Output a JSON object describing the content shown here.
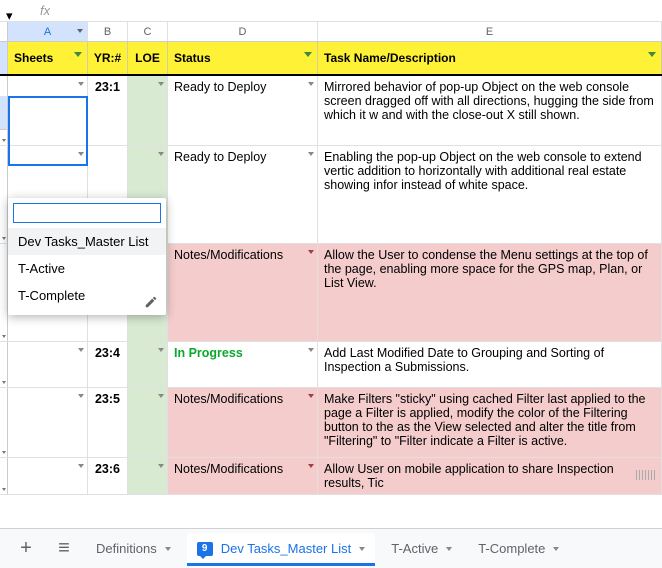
{
  "formula": {
    "fx": "fx",
    "value": ""
  },
  "col_letters": [
    "A",
    "B",
    "C",
    "D",
    "E"
  ],
  "headers": {
    "sheets": "Sheets",
    "yr": "YR:#",
    "loe": "LOE",
    "status": "Status",
    "task": "Task Name/Description"
  },
  "rows": [
    {
      "yr": "23:1",
      "status": "Ready to Deploy",
      "status_class": "",
      "desc": "Mirrored behavior of pop-up Object on the web console screen dragged off with all directions, hugging the side from which it w and with the close-out X still shown."
    },
    {
      "yr": "",
      "status": "Ready to Deploy",
      "status_class": "",
      "desc": "Enabling the pop-up Object on the web console to extend vertic addition to horizontally with additional real estate showing infor instead of white space."
    },
    {
      "yr": "",
      "status": "Notes/Modifications",
      "status_class": "pink",
      "desc": "Allow the User to condense the Menu settings at the top of the page, enabling more space for the GPS map, Plan, or List View."
    },
    {
      "yr": "23:4",
      "status": "In Progress",
      "status_class": "greenf",
      "desc": "Add Last Modified Date to Grouping and Sorting of Inspection a Submissions."
    },
    {
      "yr": "23:5",
      "status": "Notes/Modifications",
      "status_class": "pink",
      "desc": "Make Filters \"sticky\" using cached Filter last applied to the page a Filter is applied, modify the color of the Filtering button to the as the View selected and alter the title from \"Filtering\" to \"Filter indicate a Filter is active."
    },
    {
      "yr": "23:6",
      "status": "Notes/Modifications",
      "status_class": "pink",
      "desc": "Allow User on mobile application to share Inspection results, Tic"
    }
  ],
  "dropdown": {
    "items": [
      "Dev Tasks_Master List",
      "T-Active",
      "T-Complete"
    ]
  },
  "tabs": {
    "add": "+",
    "menu": "≡",
    "items": [
      "Definitions",
      "Dev Tasks_Master List",
      "T-Active",
      "T-Complete"
    ],
    "badge": "9"
  }
}
